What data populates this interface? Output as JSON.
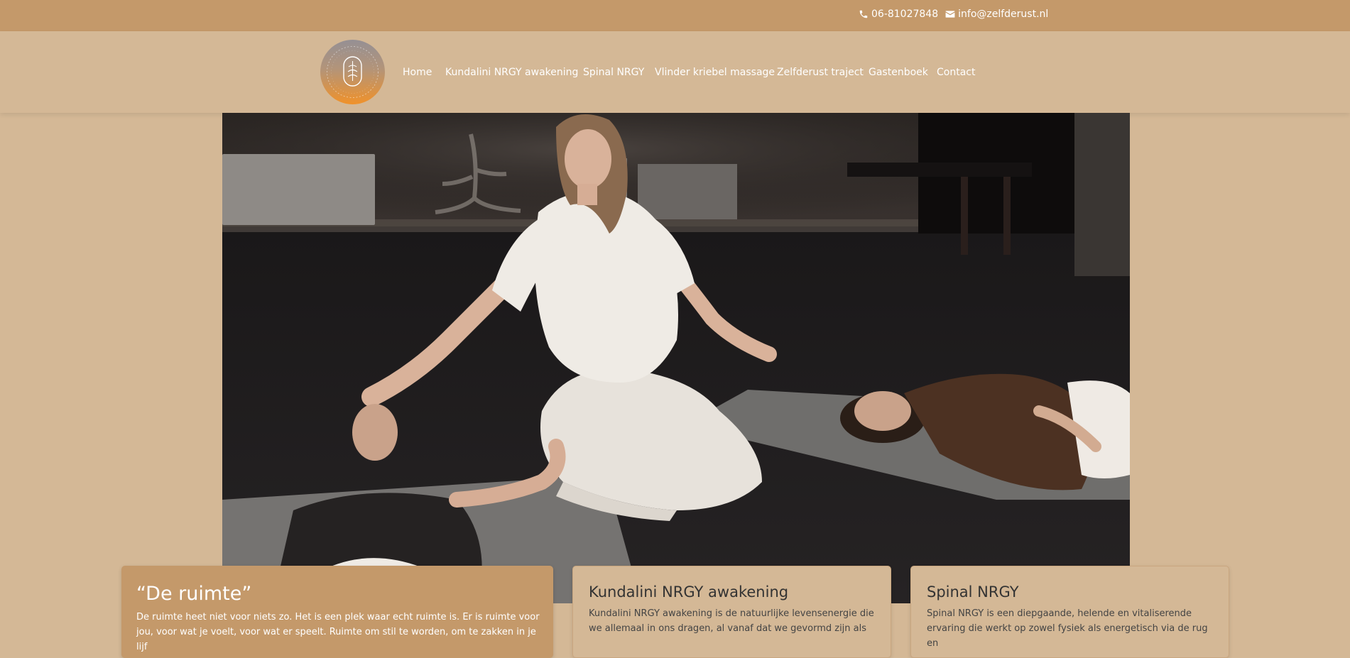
{
  "topbar": {
    "phone": "06-81027848",
    "email": "info@zelfderust.nl"
  },
  "logo": {
    "alt": "zelfderust logo"
  },
  "nav": {
    "items": [
      {
        "label": "Home"
      },
      {
        "label": "Kundalini NRGY awakening"
      },
      {
        "label": "Spinal NRGY"
      },
      {
        "label": "Vlinder kriebel massage"
      },
      {
        "label": "Zelfderust traject"
      },
      {
        "label": "Gastenboek"
      },
      {
        "label": "Contact"
      }
    ]
  },
  "cards": [
    {
      "title": "“De ruimte”",
      "text": "De ruimte heet niet voor niets zo. Het is een plek waar echt ruimte is. Er is ruimte voor jou, voor wat je voelt, voor wat er speelt. Ruimte om stil te worden, om te zakken in je lijf"
    },
    {
      "title": "Kundalini NRGY awakening",
      "text": "Kundalini NRGY awakening is de natuurlijke levensenergie die we allemaal in ons dragen, al vanaf dat we gevormd zijn als"
    },
    {
      "title": "Spinal NRGY",
      "text": "Spinal NRGY is een diepgaande, helende en vitaliserende ervaring die werkt op zowel fysiek als energetisch via de rug en"
    }
  ],
  "colors": {
    "topbar": "#c4996a",
    "background": "#d4b896",
    "accent_card": "#c4996a",
    "text_dark": "#333333"
  },
  "icons": [
    "phone-icon",
    "envelope-icon"
  ]
}
